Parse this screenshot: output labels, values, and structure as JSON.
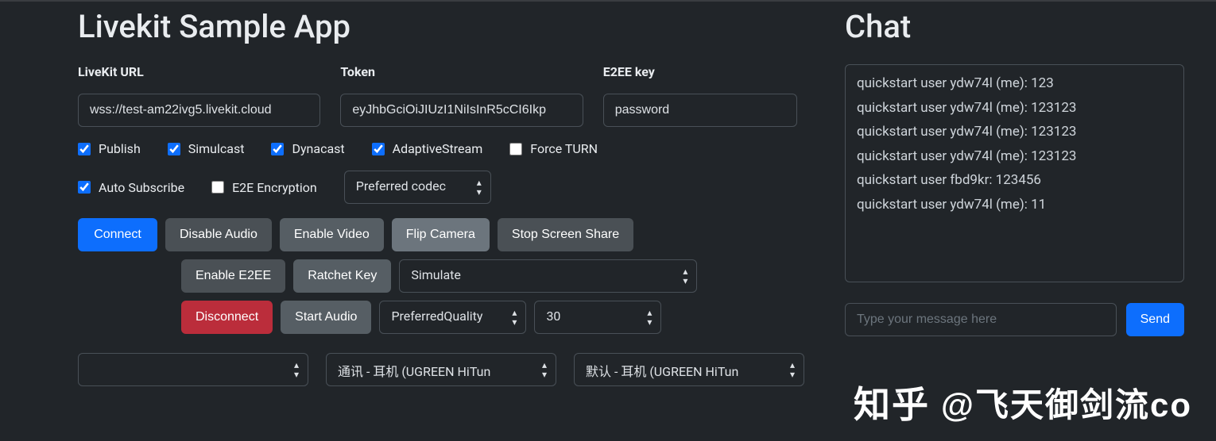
{
  "title": "Livekit Sample App",
  "fields": {
    "url_label": "LiveKit URL",
    "url_value": "wss://test-am22ivg5.livekit.cloud",
    "token_label": "Token",
    "token_value": "eyJhbGciOiJIUzI1NiIsInR5cCI6Ikp",
    "e2ee_label": "E2EE key",
    "e2ee_value": "password"
  },
  "checks": {
    "publish": "Publish",
    "simulcast": "Simulcast",
    "dynacast": "Dynacast",
    "adaptive": "AdaptiveStream",
    "force_turn": "Force TURN",
    "auto_subscribe": "Auto Subscribe",
    "e2e_encryption": "E2E Encryption"
  },
  "selects": {
    "preferred_codec": "Preferred codec",
    "simulate": "Simulate",
    "preferred_quality": "PreferredQuality",
    "fps": "30",
    "empty": "",
    "mic": "通讯 - 耳机 (UGREEN HiTun",
    "speaker": "默认 - 耳机 (UGREEN HiTun"
  },
  "buttons": {
    "connect": "Connect",
    "disable_audio": "Disable Audio",
    "enable_video": "Enable Video",
    "flip_camera": "Flip Camera",
    "stop_screen_share": "Stop Screen Share",
    "enable_e2ee": "Enable E2EE",
    "ratchet_key": "Ratchet Key",
    "disconnect": "Disconnect",
    "start_audio": "Start Audio",
    "send": "Send"
  },
  "chat": {
    "title": "Chat",
    "placeholder": "Type your message here",
    "messages": [
      "quickstart user ydw74l (me): 123",
      "quickstart user ydw74l (me): 123123",
      "quickstart user ydw74l (me): 123123",
      "quickstart user ydw74l (me): 123123",
      "quickstart user fbd9kr: 123456",
      "quickstart user ydw74l (me): 11"
    ]
  },
  "watermark": {
    "logo": "知乎",
    "text": "@飞天御剑流co"
  }
}
